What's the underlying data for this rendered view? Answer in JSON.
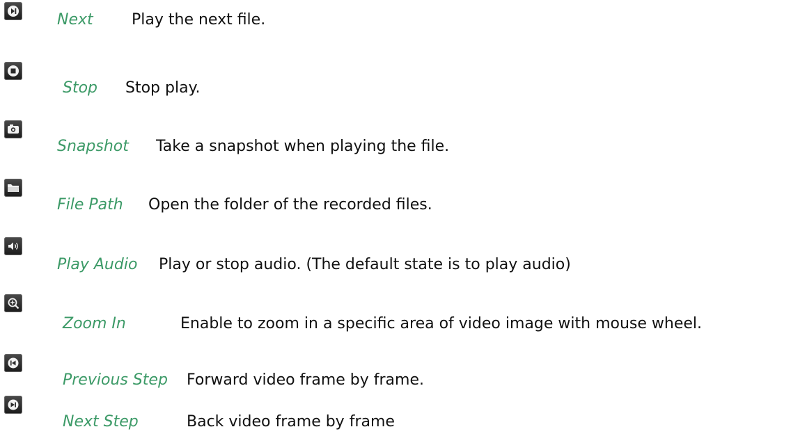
{
  "items": [
    {
      "icon": "next-file-icon",
      "term": "Next",
      "description": "Play the next file."
    },
    {
      "icon": "stop-icon",
      "term": "Stop",
      "description": "Stop play."
    },
    {
      "icon": "camera-icon",
      "term": "Snapshot",
      "description": "Take a snapshot when playing the file."
    },
    {
      "icon": "folder-icon",
      "term": "File Path",
      "description": "Open the folder of the recorded files."
    },
    {
      "icon": "speaker-icon",
      "term": "Play Audio",
      "description": "Play or stop audio. (The default state is to play audio)"
    },
    {
      "icon": "zoom-in-icon",
      "term": "Zoom In",
      "description": "Enable to zoom in a specific area of video image with mouse wheel."
    },
    {
      "icon": "previous-step-icon",
      "term": "Previous Step",
      "description": "Forward video frame by frame."
    },
    {
      "icon": "next-step-icon",
      "term": "Next Step",
      "description": "Back video frame by frame"
    }
  ],
  "colors": {
    "term": "#3c9a67",
    "text": "#111111",
    "icon_bg": "#2a2a2a"
  }
}
